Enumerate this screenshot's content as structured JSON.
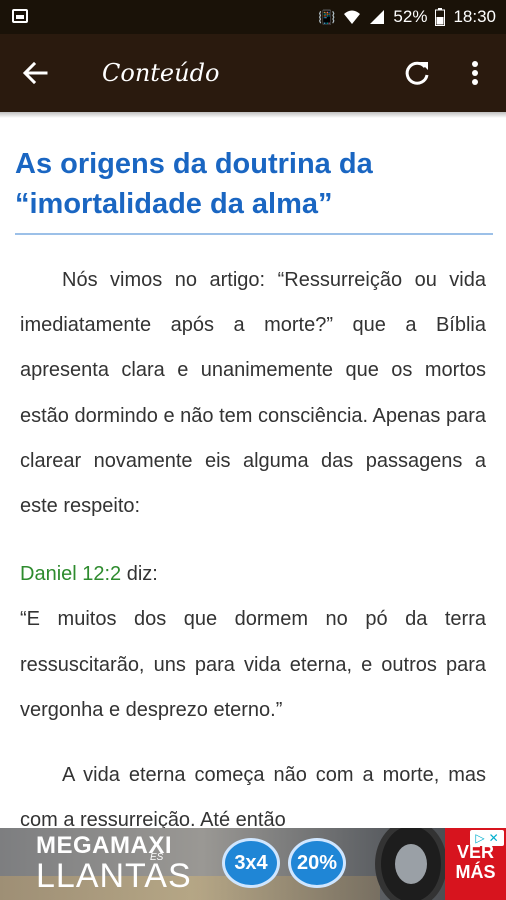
{
  "status_bar": {
    "battery": "52%",
    "time": "18:30",
    "icons": [
      "vibrate-icon",
      "wifi-icon",
      "signal-icon",
      "battery-icon"
    ]
  },
  "app_bar": {
    "title": "Conteúdo",
    "back_icon": "arrow-back-icon",
    "refresh_icon": "refresh-icon",
    "menu_icon": "more-vertical-icon"
  },
  "article": {
    "title": "As origens da doutrina da “imortalidade da alma”",
    "paragraph1": "Nós vimos no artigo: “Ressurreição ou vida imediatamente após a morte?” que a Bíblia apresenta clara e unanimemente que os mortos estão dormindo e não tem consciência. Apenas para clarear novamente eis alguma das passagens a este respeito:",
    "reference": "Daniel 12:2",
    "reference_suffix": " diz:",
    "quote": "“E muitos dos que dormem no pó da terra ressuscitarão, uns para vida eterna, e outros para vergonha e desprezo eterno.”",
    "paragraph2": "A vida eterna começa não com a morte, mas com a ressurreição. Até então"
  },
  "ad": {
    "brand_top": "MEGAMAXI",
    "brand_es": "ES",
    "brand_bottom": "LLANTAS",
    "badge1": "3x4",
    "badge2": "20%",
    "cta": "VER MÁS"
  },
  "colors": {
    "status_bar": "#1a1208",
    "app_bar": "#2a1a0e",
    "title_blue": "#1a66c2",
    "reference_green": "#2e8b2e",
    "cta_red": "#d7141e"
  }
}
